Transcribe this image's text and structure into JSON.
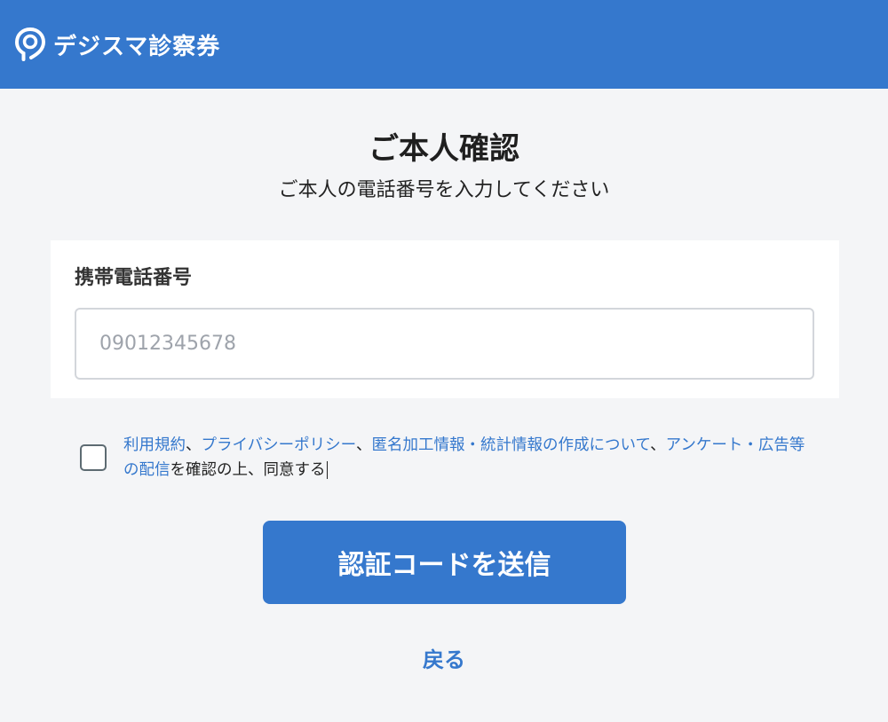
{
  "header": {
    "brand": "デジスマ診察券",
    "logo_icon": "location-pin-icon",
    "background_color": "#3578cd"
  },
  "main": {
    "title": "ご本人確認",
    "subtitle": "ご本人の電話番号を入力してください"
  },
  "form": {
    "phone_label": "携帯電話番号",
    "phone_placeholder": "09012345678",
    "phone_value": ""
  },
  "agreement": {
    "checked": false,
    "link_terms": "利用規約",
    "sep1": "、",
    "link_privacy": "プライバシーポリシー",
    "sep2": "、",
    "link_anonymized": "匿名加工情報・統計情報の作成について",
    "sep3": "、",
    "link_survey": "アンケート・広告等の配信",
    "suffix": "を確認の上、同意する"
  },
  "actions": {
    "send_label": "認証コードを送信",
    "back_label": "戻る"
  },
  "colors": {
    "accent": "#3578cd",
    "page_background": "#f4f5f7",
    "checkbox_border": "#5d6b72"
  }
}
